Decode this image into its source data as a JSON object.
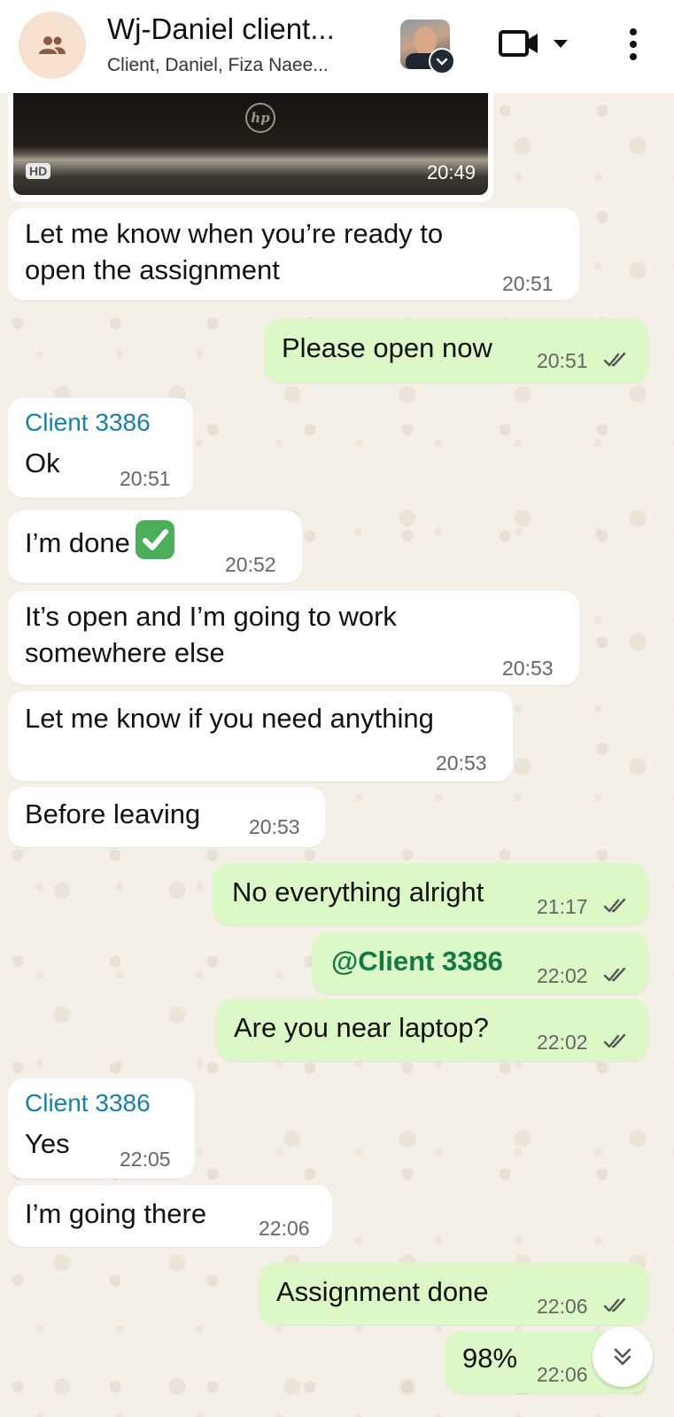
{
  "header": {
    "title": "Wj-Daniel client...",
    "subtitle": "Client, Daniel, Fiza Naee...",
    "group_icon": "group-icon",
    "video_icon": "video-call-icon",
    "menu_icon": "more-vert-icon"
  },
  "image_message": {
    "badge": "HD",
    "time": "20:49"
  },
  "messages": [
    {
      "dir": "in",
      "sender": "",
      "lines": [
        "Let me know when you’re ready to",
        "open the assignment"
      ],
      "time": "20:51"
    },
    {
      "dir": "out",
      "text": "Please open now",
      "time": "20:51"
    },
    {
      "dir": "in",
      "sender": "Client 3386",
      "text": "Ok",
      "time": "20:51"
    },
    {
      "dir": "in",
      "text": "I’m done",
      "time": "20:52",
      "emoji": "check-mark-button-emoji"
    },
    {
      "dir": "in",
      "lines": [
        "It’s open and I’m going to work",
        "somewhere else"
      ],
      "time": "20:53"
    },
    {
      "dir": "in",
      "text": "Let me know if you need anything",
      "time": "20:53"
    },
    {
      "dir": "in",
      "text": "Before leaving",
      "time": "20:53"
    },
    {
      "dir": "out",
      "text": "No everything alright",
      "time": "21:17"
    },
    {
      "dir": "out",
      "text": "@Client 3386",
      "time": "22:02"
    },
    {
      "dir": "out",
      "text": "Are you near laptop?",
      "time": "22:02"
    },
    {
      "dir": "in",
      "sender": "Client 3386",
      "text": "Yes",
      "time": "22:05"
    },
    {
      "dir": "in",
      "text": "I’m going there",
      "time": "22:06"
    },
    {
      "dir": "out",
      "text": "Assignment done",
      "time": "22:06"
    },
    {
      "dir": "out",
      "text": "98%",
      "time": "22:06"
    }
  ],
  "colors": {
    "outgoing_bubble": "#dcf8c6",
    "incoming_bubble": "#ffffff",
    "sender_name": "#1a7fa8",
    "mention": "#137a45",
    "read_tick": "#555555"
  }
}
